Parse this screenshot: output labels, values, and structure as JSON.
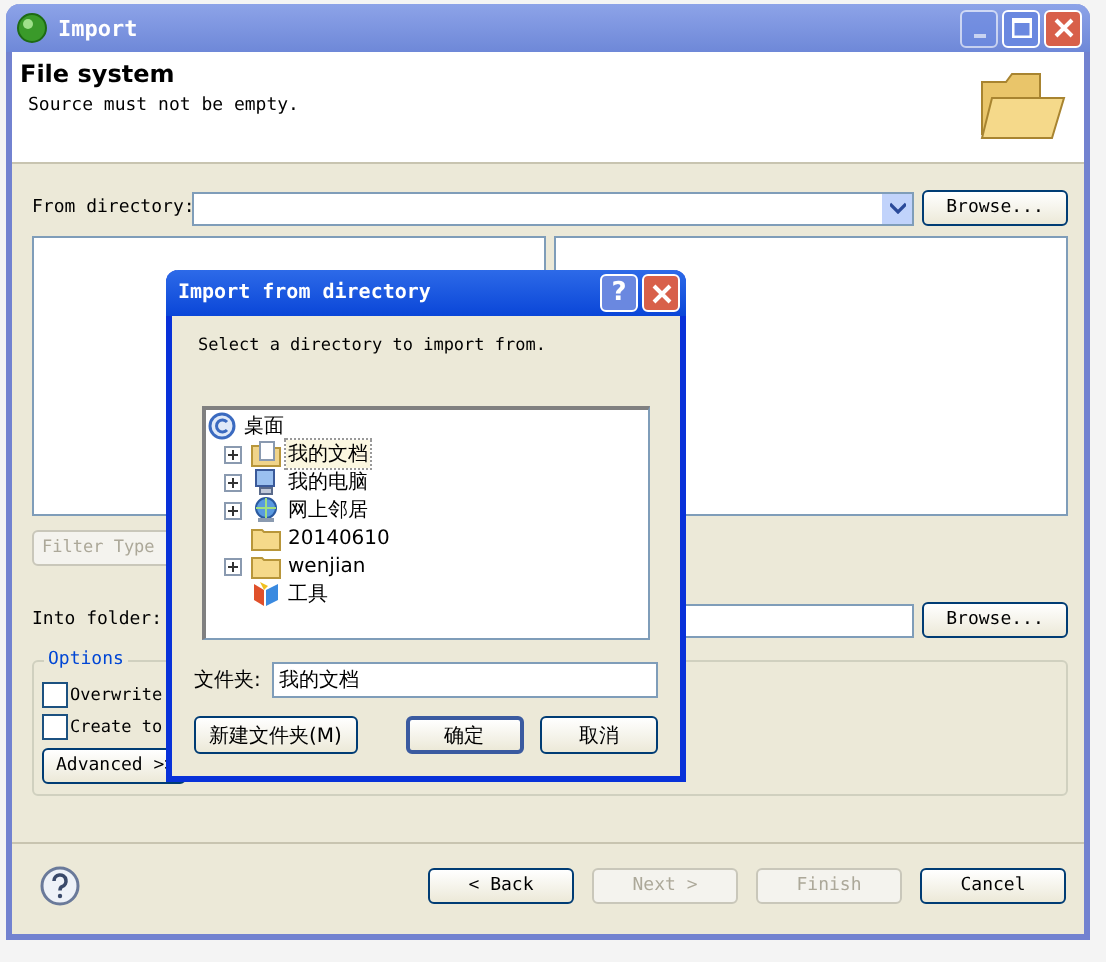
{
  "window": {
    "title": "Import"
  },
  "header": {
    "title": "File system",
    "message": "Source must not be empty."
  },
  "from_directory": {
    "label": "From directory:",
    "button": "Browse..."
  },
  "filter_button": {
    "label": "Filter Type",
    "disabled": true
  },
  "into_folder": {
    "label": "Into folder:",
    "button": "Browse..."
  },
  "options": {
    "title": "Options",
    "checkboxes": [
      {
        "label": "Overwrite",
        "checked": false
      },
      {
        "label": "Create to",
        "checked": false
      }
    ],
    "advanced": "Advanced >>"
  },
  "footer_buttons": [
    {
      "label": "< Back",
      "disabled": false
    },
    {
      "label": "Next >",
      "disabled": true
    },
    {
      "label": "Finish",
      "disabled": true
    },
    {
      "label": "Cancel",
      "disabled": false
    }
  ],
  "dialog": {
    "title": "Import from directory",
    "help": "?",
    "prompt": "Select a directory to import from.",
    "tree": {
      "label": "桌面",
      "children": [
        {
          "label": "我的文档",
          "kind": "documents",
          "expandable": true,
          "selected": true
        },
        {
          "label": "我的电脑",
          "kind": "computer",
          "expandable": true,
          "selected": false
        },
        {
          "label": "网上邻居",
          "kind": "network",
          "expandable": true,
          "selected": false
        },
        {
          "label": "20140610",
          "kind": "folder",
          "expandable": false,
          "selected": false
        },
        {
          "label": "wenjian",
          "kind": "folder",
          "expandable": true,
          "selected": false
        },
        {
          "label": "工具",
          "kind": "app",
          "expandable": false,
          "selected": false
        }
      ]
    },
    "folder_label": "文件夹:",
    "folder_value": "我的文档",
    "buttons": [
      {
        "label": "新建文件夹(M)",
        "kind": "plain"
      },
      {
        "label": "确定",
        "kind": "default"
      },
      {
        "label": "取消",
        "kind": "plain"
      }
    ]
  }
}
